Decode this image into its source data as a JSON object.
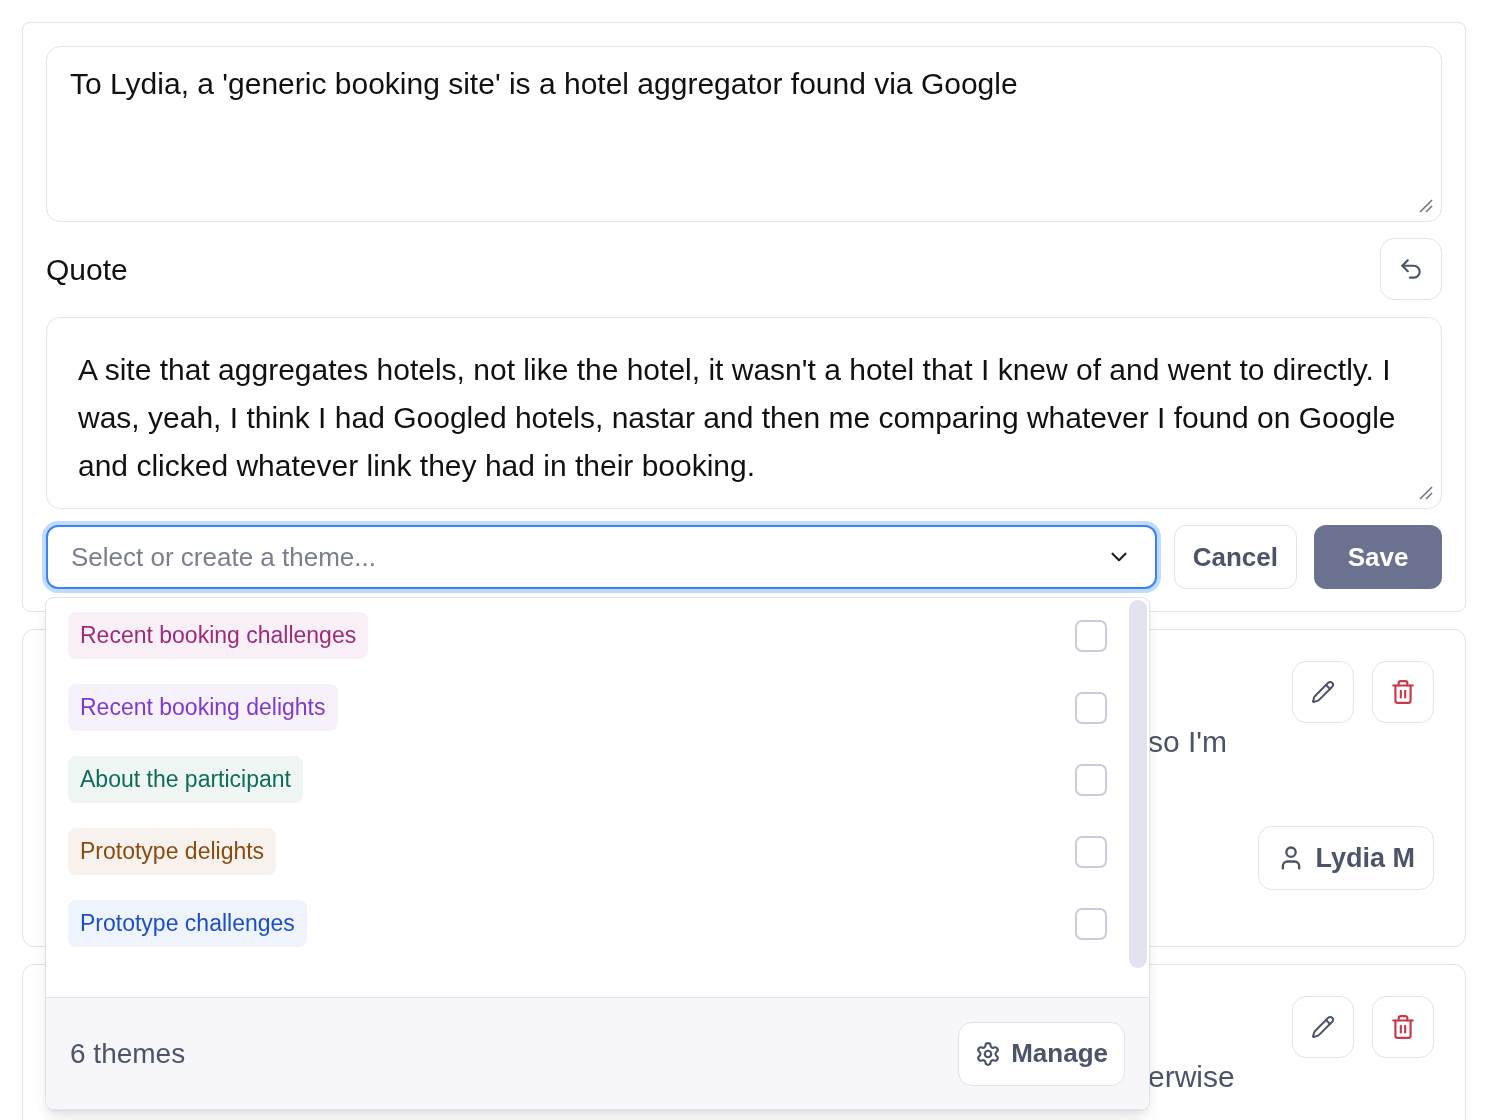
{
  "note": {
    "value": "To Lydia, a 'generic booking site' is a hotel aggregator found via Google"
  },
  "quote_label": "Quote",
  "quote": {
    "value": "A site that aggregates hotels, not like the hotel, it wasn't a hotel that I knew of and went to directly. I was, yeah, I think I had Googled hotels, nastar and then me comparing whatever I found on Google and clicked whatever link they had in their booking."
  },
  "theme_select": {
    "placeholder": "Select or create a theme...",
    "expanded": true
  },
  "buttons": [
    "Cancel",
    "Save"
  ],
  "themes": [
    {
      "label": "Recent booking challenges",
      "color": "#9b2c7a",
      "checked": false
    },
    {
      "label": "Recent booking delights",
      "color": "#7e3bc9",
      "checked": false
    },
    {
      "label": "About the participant",
      "color": "#0f6b5a",
      "checked": false
    },
    {
      "label": "Prototype delights",
      "color": "#8a4b0f",
      "checked": false
    },
    {
      "label": "Prototype challenges",
      "color": "#1d4fc4",
      "checked": false
    }
  ],
  "theme_count": "6 themes",
  "manage_button": "Manage",
  "cards": [
    {
      "lines": [
        "so I'm"
      ],
      "participant": "Lydia M"
    },
    {
      "lines": [
        "erwise"
      ]
    }
  ]
}
